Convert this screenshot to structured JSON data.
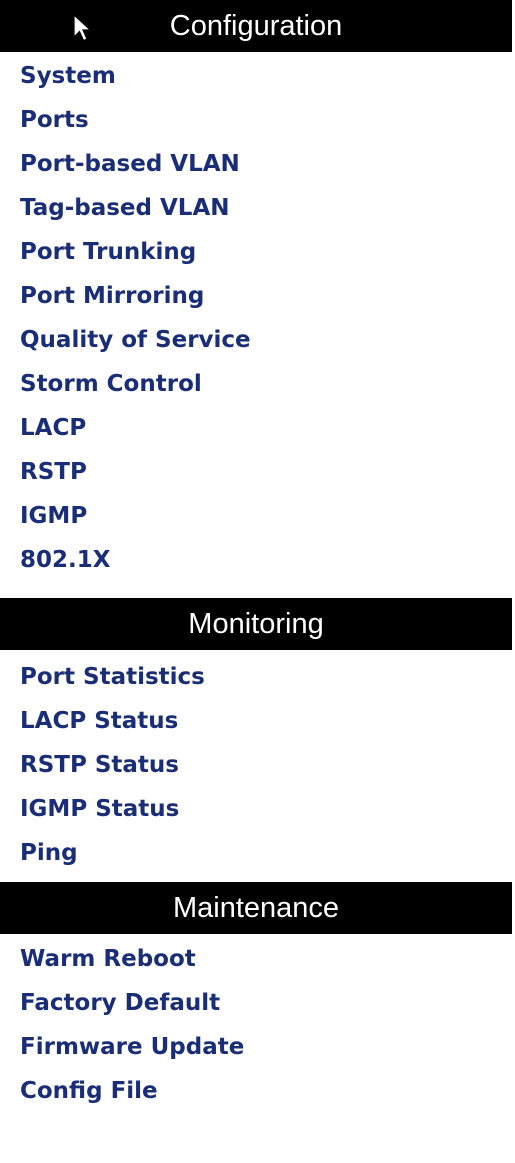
{
  "sections": [
    {
      "title": "Configuration",
      "items": [
        "System",
        "Ports",
        "Port-based VLAN",
        "Tag-based VLAN",
        "Port Trunking",
        "Port Mirroring",
        "Quality of Service",
        "Storm Control",
        "LACP",
        "RSTP",
        "IGMP",
        "802.1X"
      ]
    },
    {
      "title": "Monitoring",
      "items": [
        "Port Statistics",
        "LACP Status",
        "RSTP Status",
        "IGMP Status",
        "Ping"
      ]
    },
    {
      "title": "Maintenance",
      "items": [
        "Warm Reboot",
        "Factory Default",
        "Firmware Update",
        "Config File"
      ]
    }
  ],
  "icons": {
    "cursor": "mouse-pointer-icon"
  },
  "colors": {
    "header_bg": "#000000",
    "header_text": "#ffffff",
    "link": "#1a2d77"
  }
}
